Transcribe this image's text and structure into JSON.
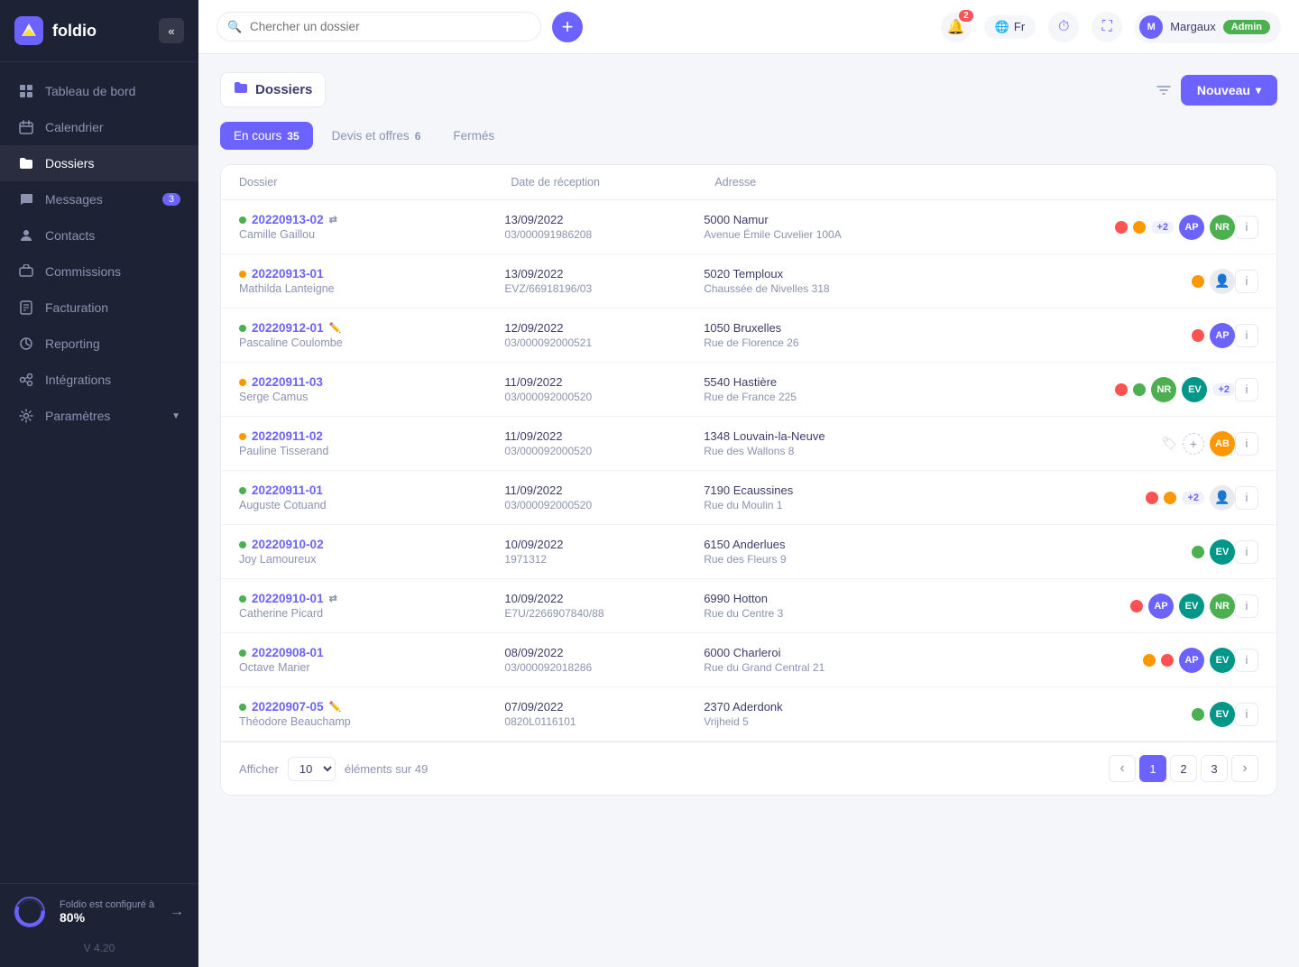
{
  "app": {
    "title": "foldio.app",
    "logo_text": "foldio"
  },
  "sidebar": {
    "collapse_label": "«",
    "nav_items": [
      {
        "id": "tableau",
        "label": "Tableau de bord",
        "icon": "grid-icon",
        "badge": null,
        "active": false
      },
      {
        "id": "calendrier",
        "label": "Calendrier",
        "icon": "calendar-icon",
        "badge": null,
        "active": false
      },
      {
        "id": "dossiers",
        "label": "Dossiers",
        "icon": "folder-icon",
        "badge": null,
        "active": true
      },
      {
        "id": "messages",
        "label": "Messages",
        "icon": "message-icon",
        "badge": "3",
        "active": false
      },
      {
        "id": "contacts",
        "label": "Contacts",
        "icon": "contact-icon",
        "badge": null,
        "active": false
      },
      {
        "id": "commissions",
        "label": "Commissions",
        "icon": "commission-icon",
        "badge": null,
        "active": false
      },
      {
        "id": "facturation",
        "label": "Facturation",
        "icon": "facturation-icon",
        "badge": null,
        "active": false
      },
      {
        "id": "reporting",
        "label": "Reporting",
        "icon": "reporting-icon",
        "badge": null,
        "active": false
      },
      {
        "id": "integrations",
        "label": "Intégrations",
        "icon": "integrations-icon",
        "badge": null,
        "active": false
      },
      {
        "id": "parametres",
        "label": "Paramètres",
        "icon": "parametres-icon",
        "badge": null,
        "active": false
      }
    ],
    "config": {
      "text": "Foldio est configuré à",
      "percent": "80%",
      "arrow_label": "→"
    },
    "version": "V 4.20"
  },
  "topbar": {
    "search_placeholder": "Chercher un dossier",
    "add_button_label": "+",
    "notifications_count": "2",
    "language": "Fr",
    "user_name": "Margaux",
    "admin_label": "Admin"
  },
  "content": {
    "page_title": "Dossiers",
    "filter_label": "≡",
    "nouveau_label": "Nouveau",
    "tabs": [
      {
        "id": "en_cours",
        "label": "En cours",
        "count": "35",
        "active": true
      },
      {
        "id": "devis",
        "label": "Devis et offres",
        "count": "6",
        "active": false
      },
      {
        "id": "fermes",
        "label": "Fermés",
        "count": null,
        "active": false
      }
    ],
    "table": {
      "columns": [
        "Dossier",
        "Date de réception",
        "Adresse",
        "",
        ""
      ],
      "rows": [
        {
          "id": "20220913-02",
          "name": "Camille Gaillou",
          "status_color": "#4caf50",
          "has_share": true,
          "has_edit": false,
          "date": "13/09/2022",
          "ref": "03/000091986208",
          "addr_city": "5000 Namur",
          "addr_street": "Avenue Émile Cuvelier 100A",
          "tags": [
            "#ff5252",
            "#ff9800"
          ],
          "plus": "+2",
          "avatars": [
            "AP",
            "NR"
          ],
          "avatar_colors": [
            "purple",
            "green"
          ]
        },
        {
          "id": "20220913-01",
          "name": "Mathilda Lanteigne",
          "status_color": "#ff9800",
          "has_share": false,
          "has_edit": false,
          "date": "13/09/2022",
          "ref": "EVZ/66918196/03",
          "addr_city": "5020 Temploux",
          "addr_street": "Chaussée de Nivelles 318",
          "tags": [
            "#ff9800"
          ],
          "plus": null,
          "avatars": [
            "person"
          ],
          "avatar_colors": [
            "person"
          ]
        },
        {
          "id": "20220912-01",
          "name": "Pascaline Coulombe",
          "status_color": "#4caf50",
          "has_share": false,
          "has_edit": true,
          "date": "12/09/2022",
          "ref": "03/000092000521",
          "addr_city": "1050 Bruxelles",
          "addr_street": "Rue de Florence 26",
          "tags": [
            "#ff5252"
          ],
          "plus": null,
          "avatars": [
            "AP"
          ],
          "avatar_colors": [
            "purple"
          ]
        },
        {
          "id": "20220911-03",
          "name": "Serge Camus",
          "status_color": "#ff9800",
          "has_share": false,
          "has_edit": false,
          "date": "11/09/2022",
          "ref": "03/000092000520",
          "addr_city": "5540 Hastière",
          "addr_street": "Rue de France 225",
          "tags": [
            "#ff5252",
            "#4caf50"
          ],
          "plus": null,
          "avatars": [
            "NR",
            "EV"
          ],
          "avatar_colors": [
            "green",
            "teal"
          ],
          "extra_plus": "+2"
        },
        {
          "id": "20220911-02",
          "name": "Pauline Tisserand",
          "status_color": "#ff9800",
          "has_share": false,
          "has_edit": false,
          "date": "11/09/2022",
          "ref": "03/000092000520",
          "addr_city": "1348 Louvain-la-Neuve",
          "addr_street": "Rue des Wallons 8",
          "tags": [],
          "plus": null,
          "has_add_tag": true,
          "avatars": [
            "AB"
          ],
          "avatar_colors": [
            "orange"
          ]
        },
        {
          "id": "20220911-01",
          "name": "Auguste Cotuand",
          "status_color": "#4caf50",
          "has_share": false,
          "has_edit": false,
          "date": "11/09/2022",
          "ref": "03/000092000520",
          "addr_city": "7190 Ecaussines",
          "addr_street": "Rue du Moulin 1",
          "tags": [
            "#ff5252",
            "#ff9800"
          ],
          "plus": "+2",
          "avatars": [
            "person"
          ],
          "avatar_colors": [
            "person"
          ]
        },
        {
          "id": "20220910-02",
          "name": "Joy Lamoureux",
          "status_color": "#4caf50",
          "has_share": false,
          "has_edit": false,
          "date": "10/09/2022",
          "ref": "1971312",
          "addr_city": "6150 Anderlues",
          "addr_street": "Rue des Fleurs 9",
          "tags": [
            "#4caf50"
          ],
          "plus": null,
          "avatars": [
            "EV"
          ],
          "avatar_colors": [
            "teal"
          ]
        },
        {
          "id": "20220910-01",
          "name": "Catherine Picard",
          "status_color": "#4caf50",
          "has_share": true,
          "has_edit": false,
          "date": "10/09/2022",
          "ref": "E7U/2266907840/88",
          "addr_city": "6990 Hotton",
          "addr_street": "Rue du Centre 3",
          "tags": [
            "#ff5252"
          ],
          "plus": null,
          "avatars": [
            "AP",
            "EV",
            "NR"
          ],
          "avatar_colors": [
            "purple",
            "teal",
            "green"
          ]
        },
        {
          "id": "20220908-01",
          "name": "Octave Marier",
          "status_color": "#4caf50",
          "has_share": false,
          "has_edit": false,
          "date": "08/09/2022",
          "ref": "03/000092018286",
          "addr_city": "6000 Charleroi",
          "addr_street": "Rue du Grand Central 21",
          "tags": [
            "#ff9800",
            "#ff5252"
          ],
          "plus": null,
          "avatars": [
            "AP",
            "EV"
          ],
          "avatar_colors": [
            "purple",
            "teal"
          ]
        },
        {
          "id": "20220907-05",
          "name": "Théodore Beauchamp",
          "status_color": "#4caf50",
          "has_share": false,
          "has_edit": true,
          "date": "07/09/2022",
          "ref": "0820L0116101",
          "addr_city": "2370 Aderdonk",
          "addr_street": "Vrijheid 5",
          "tags": [
            "#4caf50"
          ],
          "plus": null,
          "avatars": [
            "EV"
          ],
          "avatar_colors": [
            "teal"
          ]
        }
      ]
    },
    "pagination": {
      "show_label": "Afficher",
      "per_page": "10",
      "total_label": "éléments sur 49",
      "pages": [
        "1",
        "2",
        "3"
      ],
      "current_page": "1"
    }
  }
}
